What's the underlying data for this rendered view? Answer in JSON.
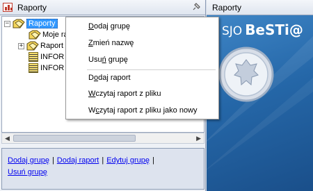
{
  "left_panel": {
    "title": "Raporty",
    "tree": [
      {
        "label": "Raporty",
        "expander": "−",
        "selected": true
      },
      {
        "label": "Moje ra"
      },
      {
        "label": "Raport",
        "expander": "+"
      },
      {
        "label": "INFOR"
      },
      {
        "label": "INFOR"
      }
    ]
  },
  "actions": {
    "add_group": "Dodaj grupę",
    "add_report": "Dodaj raport",
    "edit_group": "Edytuj grupę",
    "delete_group": "Usuń grupę",
    "separator": "|"
  },
  "right_panel": {
    "title": "Raporty",
    "banner_prefix": "SJO",
    "banner_brand": "BeSTi@"
  },
  "context_menu": {
    "items": [
      {
        "pre": "",
        "u": "D",
        "post": "odaj grupę"
      },
      {
        "pre": "",
        "u": "Z",
        "post": "mień nazwę"
      },
      {
        "pre": "Usu",
        "u": "ń",
        "post": " grupę"
      },
      {
        "pre": "D",
        "u": "o",
        "post": "daj raport"
      },
      {
        "pre": "",
        "u": "W",
        "post": "czytaj raport z pliku"
      },
      {
        "pre": "W",
        "u": "c",
        "post": "zytaj raport z pliku jako nowy"
      }
    ]
  }
}
